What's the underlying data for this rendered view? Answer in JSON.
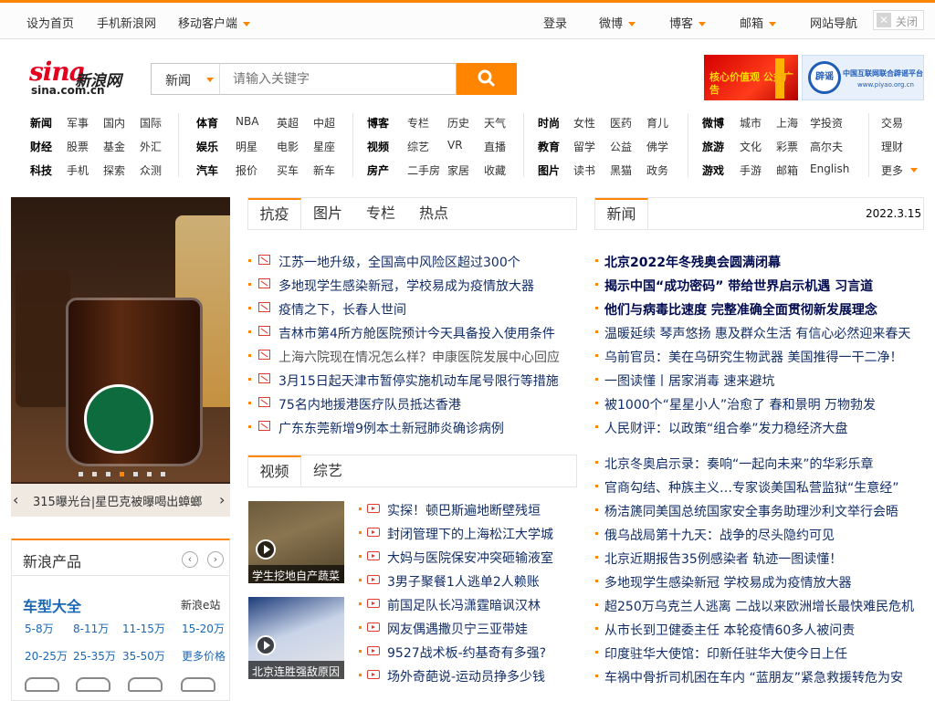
{
  "topbar": {
    "left_links": [
      "设为首页",
      "手机新浪网",
      "移动客户端"
    ],
    "right_links": [
      "登录",
      "微博",
      "博客",
      "邮箱",
      "网站导航"
    ],
    "close_label": "关闭"
  },
  "logo": {
    "text": "sina",
    "cn": "新浪网",
    "url": "sina.com.cn"
  },
  "search": {
    "category": "新闻",
    "placeholder": "请输入关键字"
  },
  "banners": {
    "left": "核心价值观 公益广告",
    "right_badge": "辟谣",
    "right_title": "中国互联网联合辟谣平台",
    "right_url": "www.piyao.org.cn"
  },
  "nav": {
    "groups": [
      [
        [
          "新闻",
          "军事",
          "国内",
          "国际"
        ],
        [
          "财经",
          "股票",
          "基金",
          "外汇"
        ],
        [
          "科技",
          "手机",
          "探索",
          "众测"
        ]
      ],
      [
        [
          "体育",
          "NBA",
          "英超",
          "中超"
        ],
        [
          "娱乐",
          "明星",
          "电影",
          "星座"
        ],
        [
          "汽车",
          "报价",
          "买车",
          "新车"
        ]
      ],
      [
        [
          "博客",
          "专栏",
          "历史",
          "天气"
        ],
        [
          "视频",
          "综艺",
          "VR",
          "直播"
        ],
        [
          "房产",
          "二手房",
          "家居",
          "收藏"
        ]
      ],
      [
        [
          "时尚",
          "女性",
          "医药",
          "育儿"
        ],
        [
          "教育",
          "留学",
          "公益",
          "佛学"
        ],
        [
          "图片",
          "读书",
          "黑猫",
          "政务"
        ]
      ],
      [
        [
          "微博",
          "城市",
          "上海",
          "学投资"
        ],
        [
          "旅游",
          "文化",
          "彩票",
          "高尔夫"
        ],
        [
          "游戏",
          "手游",
          "邮箱",
          "English"
        ]
      ],
      [
        [
          "交易"
        ],
        [
          "理财"
        ],
        [
          "更多"
        ]
      ]
    ]
  },
  "carousel": {
    "caption": "315曝光台|星巴克被曝喝出蟑螂",
    "prev": "‹",
    "next": "›",
    "dot_count": 7,
    "active_dot": 4
  },
  "products": {
    "title": "新浪产品",
    "car_title": "车型大全",
    "ebiz": "新浪e站",
    "prices": [
      [
        "5-8万",
        "8-11万",
        "11-15万",
        "15-20万"
      ],
      [
        "20-25万",
        "25-35万",
        "35-50万",
        "更多价格"
      ]
    ]
  },
  "tabs_mid": [
    "抗疫",
    "图片",
    "专栏",
    "热点"
  ],
  "tabs_right": [
    "新闻"
  ],
  "date": "2022.3.15",
  "epidemic_news": [
    "江苏一地升级，全国高中风险区超过300个",
    "多地现学生感染新冠，学校易成为疫情放大器",
    "疫情之下，长春人世间",
    "吉林市第4所方舱医院预计今天具备投入使用条件",
    "上海六院现在情况怎么样？申康医院发展中心回应",
    "3月15日起天津市暂停实施机动车尾号限行等措施",
    "75名内地援港医疗队员抵达香港",
    "广东东莞新增9例本土新冠肺炎确诊病例"
  ],
  "tabs_video": [
    "视频",
    "综艺"
  ],
  "video_thumbs": [
    "学生挖地自产蔬菜",
    "北京连胜强敌原因"
  ],
  "video_news": [
    "实探！顿巴斯遍地断壁残垣",
    "封闭管理下的上海松江大学城",
    "大妈与医院保安冲突砸输液室",
    "3男子聚餐1人逃单2人赖账",
    "前国足队长冯潇霆暗讽汉林",
    "网友偶遇撒贝宁三亚带娃",
    "9527战术板-约基奇有多强?",
    "场外奇葩说-运动员挣多少钱"
  ],
  "headline_news": [
    "北京2022年冬残奥会圆满闭幕",
    "揭示中国“成功密码” 带给世界启示机遇 习言道",
    "他们与病毒比速度 完整准确全面贯彻新发展理念"
  ],
  "right_news_a": [
    "温暖延续 琴声悠扬 惠及群众生活 有信心必然迎来春天",
    "乌前官员：美在乌研究生物武器 美国推得一干二净！",
    "一图读懂丨居家消毒 速来避坑",
    "被1000个“星星小人”治愈了 春和景明 万物勃发",
    "人民财评：以政策“组合拳”发力稳经济大盘"
  ],
  "right_news_b": [
    "北京冬奥启示录：奏响“一起向未来”的华彩乐章",
    "官商勾结、种族主义…专家谈美国私营监狱“生意经”",
    "杨洁篪同美国总统国家安全事务助理沙利文举行会晤",
    "俄乌战局第十九天：战争的尽头隐约可见",
    "北京近期报告35例感染者 轨迹一图读懂！",
    "多地现学生感染新冠 学校易成为疫情放大器",
    "超250万乌克兰人逃离 二战以来欧洲增长最快难民危机",
    "从市长到卫健委主任 本轮疫情60多人被问责",
    "印度驻华大使馆：印新任驻华大使今日上任",
    "车祸中骨折司机困在车内 “蓝朋友”紧急救援转危为安"
  ],
  "colors": {
    "accent": "#ff8400",
    "link": "#122e67",
    "brand_red": "#e4001f"
  }
}
